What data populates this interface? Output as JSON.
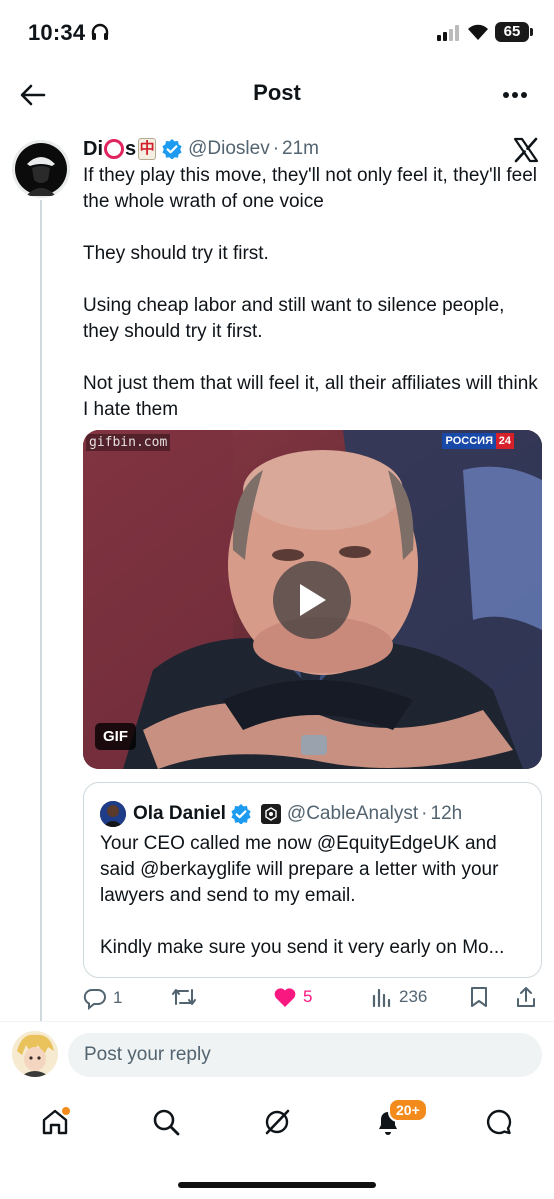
{
  "status_bar": {
    "time": "10:34",
    "battery": "65"
  },
  "header": {
    "title": "Post"
  },
  "post": {
    "display_name": "Di",
    "display_name_suffix": "s",
    "emoji_tile": "中",
    "handle": "@Dioslev",
    "dot": "·",
    "timestamp": "21m",
    "paragraphs": [
      "If they play this move, they'll not only feel it, they'll feel the whole wrath of one voice",
      "They should try it first.",
      "Using cheap labor and still want to silence people, they should try it first.",
      "Not just them that will feel it, all their affiliates will think I hate them"
    ],
    "media": {
      "watermark": "gifbin.com",
      "channel": "РОССИЯ",
      "channel_number": "24",
      "badge": "GIF"
    },
    "quote": {
      "name": "Ola Daniel",
      "handle": "@CableAnalyst",
      "dot": "·",
      "timestamp": "12h",
      "paragraphs": [
        "Your CEO called me now @EquityEdgeUK and",
        "said @berkayglife will prepare a letter with your",
        "lawyers and send to my email.",
        "Kindly make sure you send it very early on Mo..."
      ]
    },
    "actions": {
      "replies": "1",
      "likes": "5",
      "views": "236"
    }
  },
  "reply": {
    "placeholder": "Post your reply"
  },
  "nav": {
    "notifications_badge": "20+"
  },
  "colors": {
    "verified": "#1d9bf0",
    "like": "#f91880",
    "badge": "#f28b1c",
    "muted": "#536471"
  }
}
